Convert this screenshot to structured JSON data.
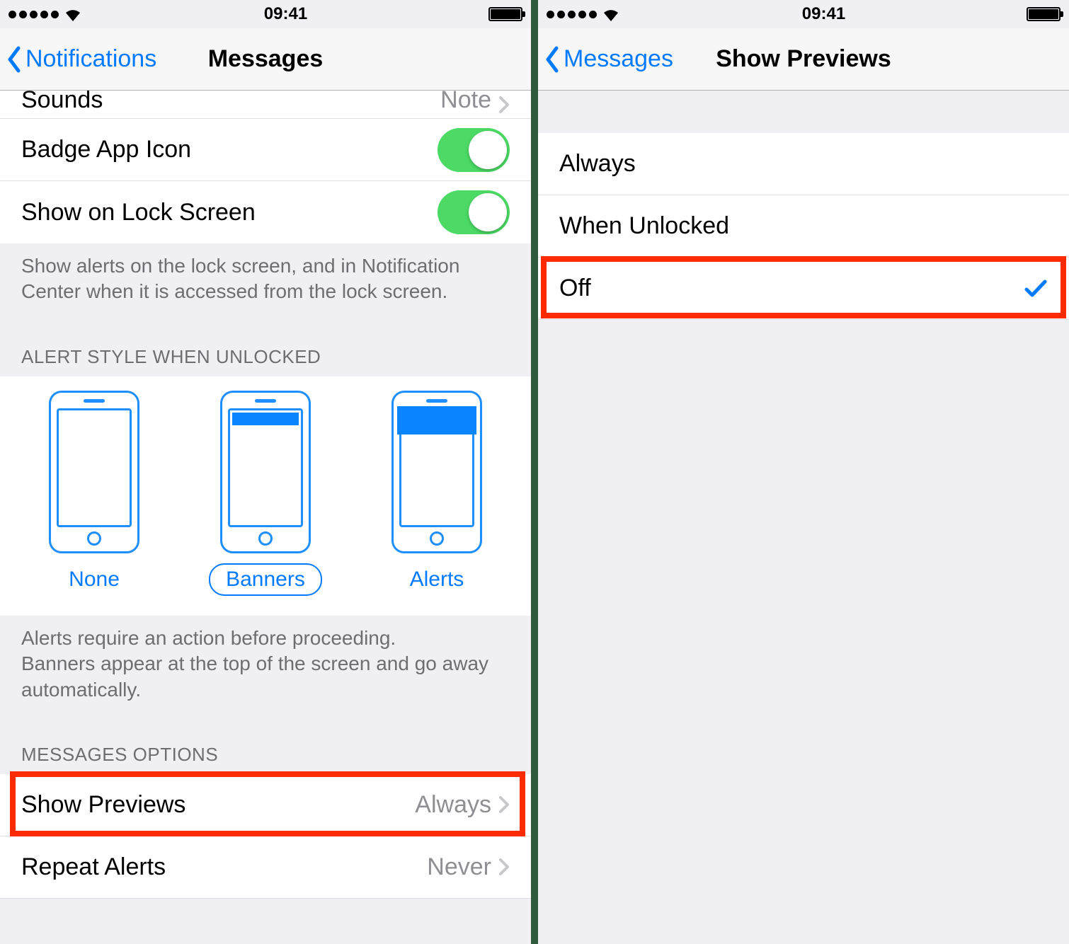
{
  "status": {
    "time": "09:41"
  },
  "left": {
    "back_label": "Notifications",
    "title": "Messages",
    "clipped_row": {
      "label": "Sounds",
      "value": "Note"
    },
    "rows1": [
      {
        "label": "Badge App Icon",
        "toggle": true
      },
      {
        "label": "Show on Lock Screen",
        "toggle": true
      }
    ],
    "footer1": "Show alerts on the lock screen, and in Notification Center when it is accessed from the lock screen.",
    "header2": "ALERT STYLE WHEN UNLOCKED",
    "styles": [
      {
        "label": "None"
      },
      {
        "label": "Banners",
        "selected": true
      },
      {
        "label": "Alerts"
      }
    ],
    "footer2": "Alerts require an action before proceeding.\nBanners appear at the top of the screen and go away automatically.",
    "header3": "MESSAGES OPTIONS",
    "rows3": [
      {
        "label": "Show Previews",
        "value": "Always"
      },
      {
        "label": "Repeat Alerts",
        "value": "Never"
      }
    ]
  },
  "right": {
    "back_label": "Messages",
    "title": "Show Previews",
    "options": [
      {
        "label": "Always",
        "checked": false
      },
      {
        "label": "When Unlocked",
        "checked": false
      },
      {
        "label": "Off",
        "checked": true
      }
    ]
  }
}
